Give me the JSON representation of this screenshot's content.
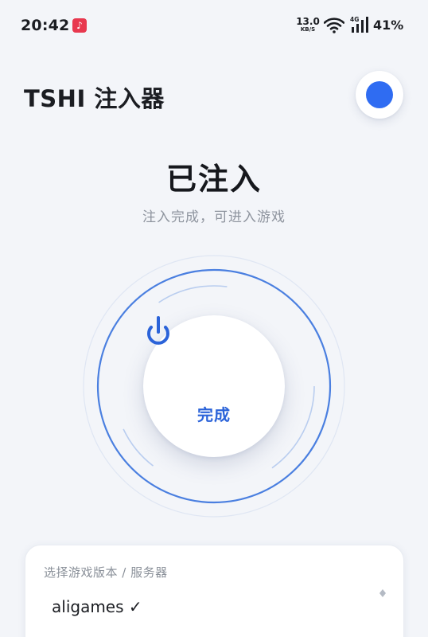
{
  "status_bar": {
    "time": "20:42",
    "music_icon": "music-app-icon",
    "speed_value": "13.0",
    "speed_unit": "KB/S",
    "network_type": "4G",
    "battery": "41%"
  },
  "header": {
    "title": "TSHI 注入器",
    "status_color": "#2f6cf2"
  },
  "state": {
    "title": "已注入",
    "subtitle": "注入完成，可进入游戏"
  },
  "action": {
    "label": "完成",
    "icon": "power-icon",
    "accent": "#2b63d9"
  },
  "server_select": {
    "label": "选择游戏版本 / 服务器",
    "value": "aligames ✓",
    "icon": "dropdown-diamond-icon"
  }
}
